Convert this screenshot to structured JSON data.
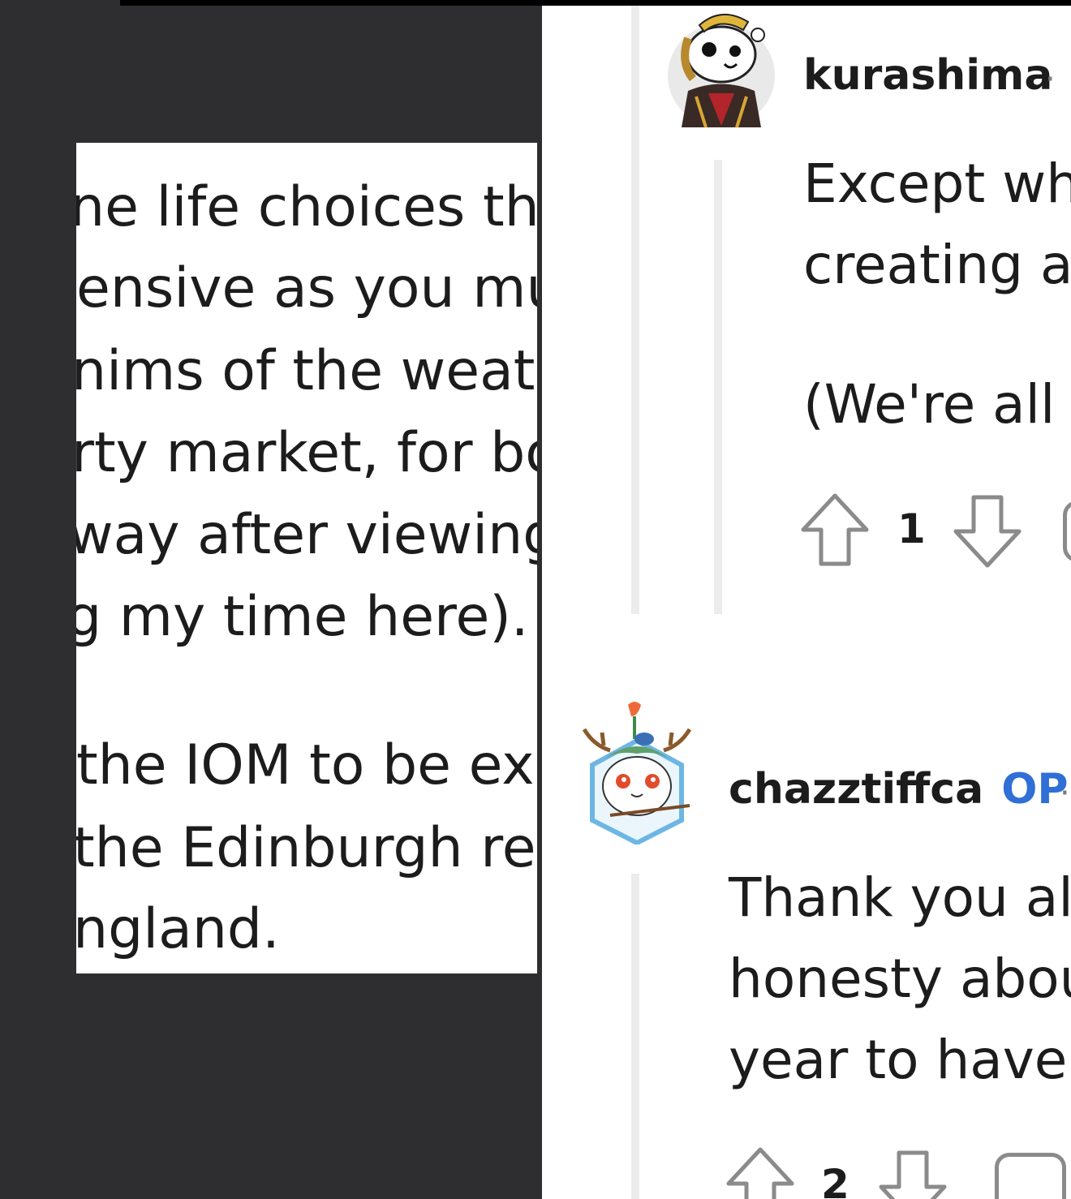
{
  "left_panel": {
    "lines": [
      "ne life choices that",
      "ensive as you mus",
      "nims of the weathe",
      "rty market, for bot",
      "way after viewing y",
      "g my time here).",
      "the IOM to be exp",
      "the Edinburgh reg",
      "ngland."
    ]
  },
  "comments": [
    {
      "username": "kurashima",
      "separator": "·",
      "avatar_icon": "snoo-avatar-knight-icon",
      "body_lines": [
        "Except whe",
        "creating a",
        "(We're all w"
      ],
      "upvotes": "1"
    },
    {
      "username": "chazztiffca",
      "op_label": "OP",
      "separator": "·",
      "avatar_icon": "snoo-avatar-deer-cat-icon",
      "body_lines": [
        "Thank you all",
        "honesty abou",
        "year to have a"
      ],
      "upvotes": "2"
    }
  ],
  "colors": {
    "background": "#2e2e30",
    "panel": "#ffffff",
    "text": "#1c1c1c",
    "op_badge": "#2f6fd6",
    "thread_line": "#ececec",
    "icon_stroke": "#8b8b8b"
  }
}
